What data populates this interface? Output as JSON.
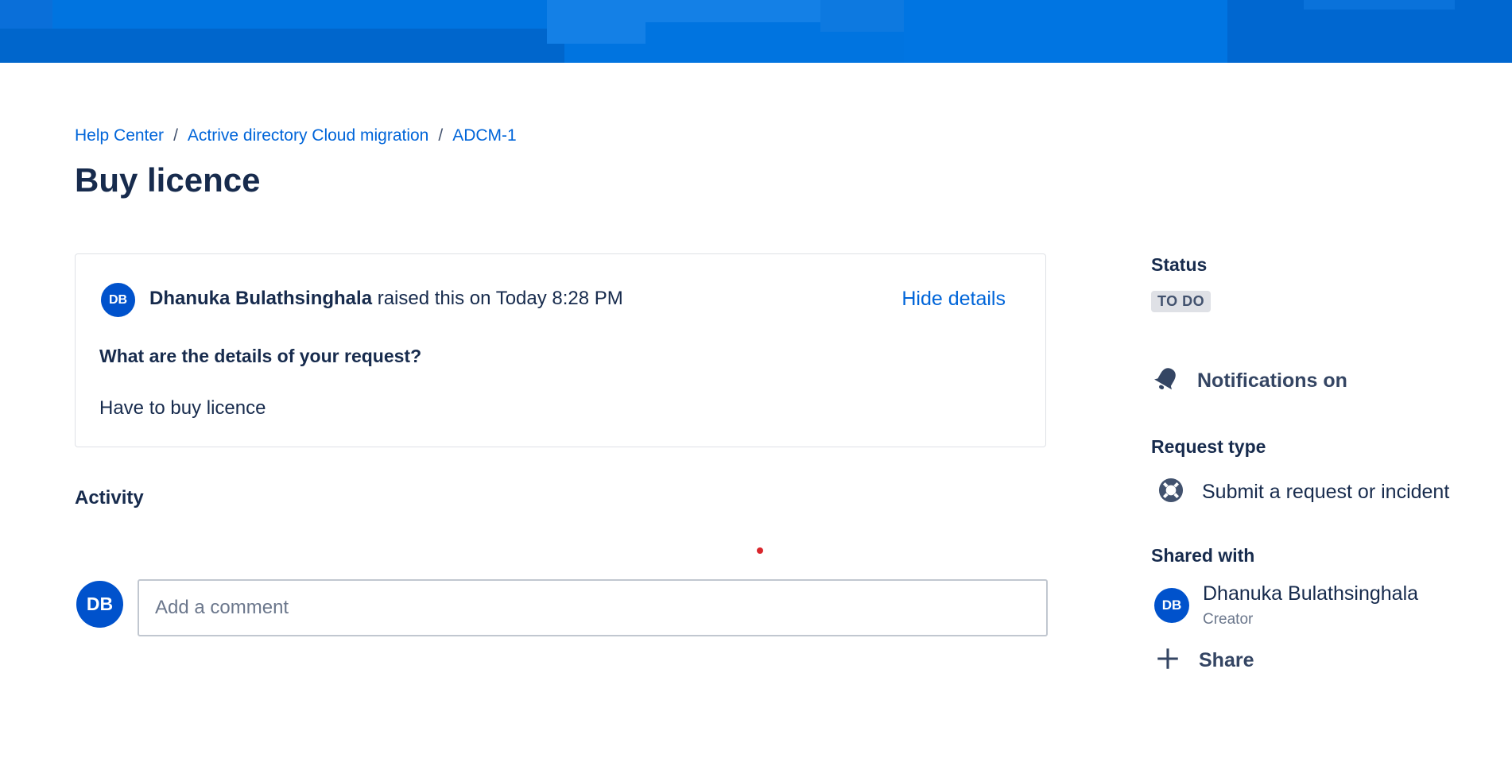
{
  "breadcrumb": {
    "items": [
      "Help Center",
      "Actrive directory Cloud migration",
      "ADCM-1"
    ],
    "separator": "/"
  },
  "page_title": "Buy licence",
  "request": {
    "reporter_initials": "DB",
    "reporter_name": "Dhanuka Bulathsinghala",
    "raised_text": "raised this on Today 8:28 PM",
    "hide_details_label": "Hide details",
    "question": "What are the details of your request?",
    "answer": "Have to buy licence"
  },
  "activity": {
    "heading": "Activity",
    "user_initials": "DB",
    "comment_placeholder": "Add a comment"
  },
  "sidebar": {
    "status_label": "Status",
    "status_value": "TO DO",
    "notifications_label": "Notifications on",
    "request_type_label": "Request type",
    "request_type_value": "Submit a request or incident",
    "shared_with_label": "Shared with",
    "shared_initials": "DB",
    "shared_name": "Dhanuka Bulathsinghala",
    "shared_role": "Creator",
    "share_label": "Share"
  },
  "icons": {
    "notifications": "bell-icon",
    "request_type": "lifebuoy-icon",
    "share": "plus-icon"
  },
  "colors": {
    "banner": "#0074e0",
    "link": "#0065d9",
    "avatar": "#0052cc",
    "status_badge_bg": "#dfe1e6"
  }
}
